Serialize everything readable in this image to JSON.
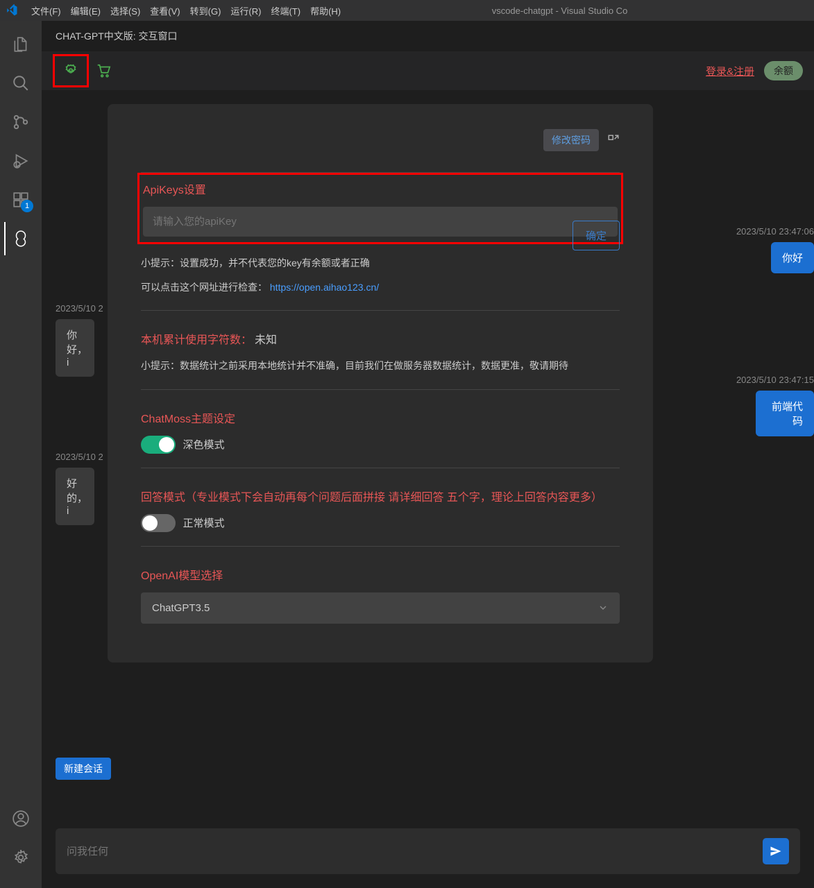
{
  "menubar": {
    "items": [
      "文件(F)",
      "编辑(E)",
      "选择(S)",
      "查看(V)",
      "转到(G)",
      "运行(R)",
      "终端(T)",
      "帮助(H)"
    ],
    "window_title": "vscode-chatgpt - Visual Studio Co"
  },
  "activitybar": {
    "extensions_badge": "1"
  },
  "panel": {
    "tab_title": "CHAT-GPT中文版: 交互窗口",
    "login_register": "登录&注册",
    "balance": "余额"
  },
  "chat": {
    "msg1_time": "2023/5/10 23:47:06",
    "msg1_text": "你好",
    "msg2_time": "2023/5/10 2",
    "msg2_text": "你好，i",
    "msg3_time": "2023/5/10 23:47:15",
    "msg3_text": "前端代码",
    "msg4_time": "2023/5/10 2",
    "msg4_text": "好的，i",
    "new_chat": "新建会话",
    "input_placeholder": "问我任何"
  },
  "modal": {
    "change_password": "修改密码",
    "apikeys_title": "ApiKeys设置",
    "apikey_placeholder": "请输入您的apiKey",
    "confirm": "确定",
    "tip1": "小提示：设置成功，并不代表您的key有余额或者正确",
    "tip2_prefix": "可以点击这个网址进行检查：",
    "tip2_link": "https://open.aihao123.cn/",
    "char_count_label": "本机累计使用字符数：",
    "char_count_value": "未知",
    "char_tip": "小提示：数据统计之前采用本地统计并不准确，目前我们在做服务器数据统计，数据更准，敬请期待",
    "theme_title": "ChatMoss主题设定",
    "theme_dark": "深色模式",
    "answer_mode_title": "回答模式（专业模式下会自动再每个问题后面拼接 请详细回答 五个字，理论上回答内容更多）",
    "answer_mode_normal": "正常模式",
    "model_title": "OpenAI模型选择",
    "model_selected": "ChatGPT3.5"
  }
}
